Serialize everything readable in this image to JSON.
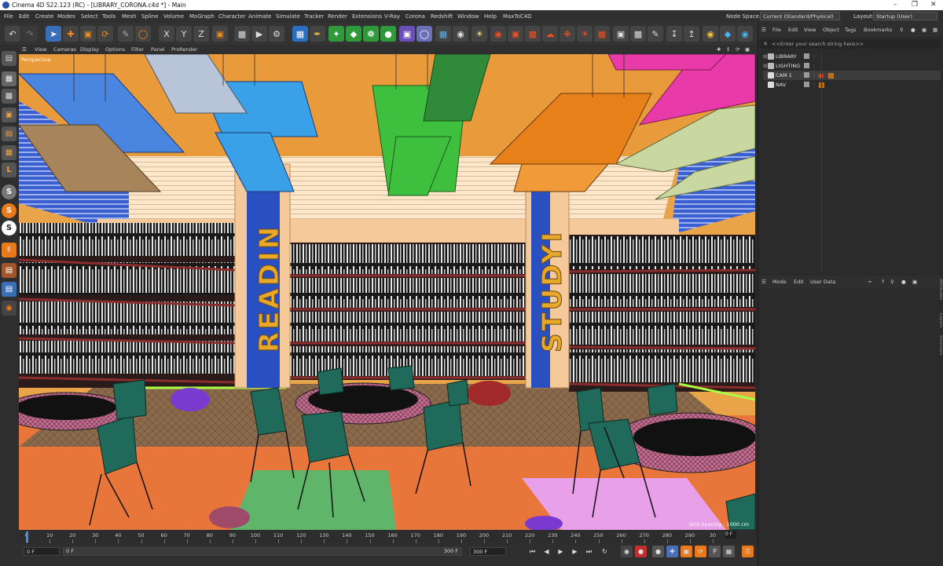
{
  "window": {
    "title": "Cinema 4D S22.123 (RC) - [LIBRARY_CORONA.c4d *] - Main"
  },
  "menu": {
    "items": [
      "File",
      "Edit",
      "Create",
      "Modes",
      "Select",
      "Tools",
      "Mesh",
      "Spline",
      "Volume",
      "MoGraph",
      "Character",
      "Animate",
      "Simulate",
      "Tracker",
      "Render",
      "Extensions",
      "V-Ray",
      "Corona",
      "Redshift",
      "Window",
      "Help",
      "MaxToC4D"
    ],
    "node_space_label": "Node Space:",
    "node_space_value": "Current (Standard/Physical)",
    "layout_label": "Layout:",
    "layout_value": "Startup (User)"
  },
  "viewport": {
    "menu": [
      "View",
      "Cameras",
      "Display",
      "Options",
      "Filter",
      "Panel",
      "ProRender"
    ],
    "label": "Perspective",
    "grid_spacing": "Grid Spacing : 1000 cm",
    "scene_text_left": "READIN",
    "scene_text_right": "STUDYI"
  },
  "object_manager": {
    "menu": [
      "File",
      "Edit",
      "View",
      "Object",
      "Tags",
      "Bookmarks"
    ],
    "search_placeholder": "<<Enter your search string here>>",
    "objects": [
      {
        "name": "LIBRARY"
      },
      {
        "name": "LIGHTING"
      },
      {
        "name": "CAM 1"
      },
      {
        "name": "NAV"
      }
    ]
  },
  "attribute_manager": {
    "menu": [
      "Mode",
      "Edit",
      "User Data"
    ],
    "side_tabs": [
      "Attributes",
      "Layers",
      "Structure"
    ]
  },
  "timeline": {
    "ticks": [
      "0",
      "10",
      "20",
      "30",
      "40",
      "50",
      "60",
      "70",
      "80",
      "90",
      "100",
      "110",
      "120",
      "130",
      "140",
      "150",
      "160",
      "170",
      "180",
      "190",
      "200",
      "210",
      "220",
      "230",
      "240",
      "250",
      "260",
      "270",
      "280",
      "290",
      "30"
    ],
    "current_frame": "0 F"
  },
  "transport": {
    "start_frame": "0 F",
    "min_frame": "0 F",
    "max_frame": "300 F",
    "end_frame": "300 F"
  },
  "colors": {
    "accent_orange": "#f07a1c",
    "shelf_red": "#8b2d2d",
    "floor_orange": "#e8763a"
  }
}
